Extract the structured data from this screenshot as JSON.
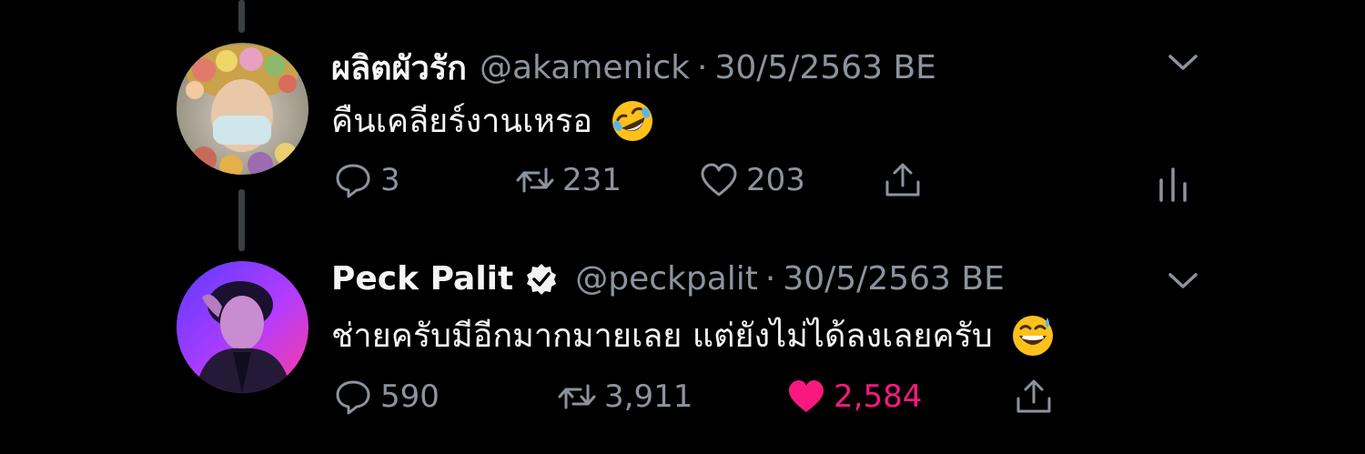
{
  "thread": [
    {
      "display_name": "ผลิตผัวรัก",
      "handle": "@akamenick",
      "separator": "·",
      "date": "30/5/2563 BE",
      "text": "คืนเคลียร์งานเหรอ",
      "emoji": "rolling-on-floor-laughing-emoji",
      "verified": false,
      "actions": {
        "replies": "3",
        "retweets": "231",
        "likes": "203",
        "liked": false
      }
    },
    {
      "display_name": "Peck Palit",
      "handle": "@peckpalit",
      "separator": "·",
      "date": "30/5/2563 BE",
      "text": "ช่ายครับมีอีกมากมายเลย แต่ยังไม่ได้ลงเลยครับ",
      "emoji": "grinning-sweat-emoji",
      "verified": true,
      "actions": {
        "replies": "590",
        "retweets": "3,911",
        "likes": "2,584",
        "liked": true
      }
    }
  ],
  "colors": {
    "background": "#000000",
    "text": "#f2f2f2",
    "muted": "#8b949e",
    "like": "#f91880",
    "thread_line": "#3a3f44"
  }
}
